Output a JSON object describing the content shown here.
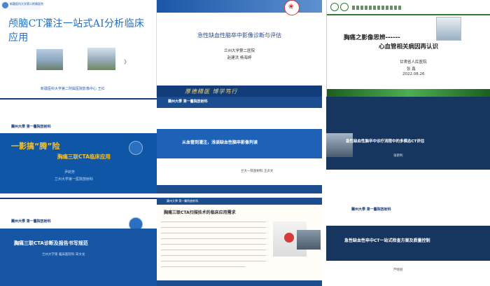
{
  "tiles": {
    "t1": {
      "logo_text": "新疆医科大学第二附属医院",
      "title": "颅脑CT灌注一站式AI分析临床应用",
      "footer": "新疆医科大学第二附属医院影像中心    王红"
    },
    "t2": {
      "title": "急性缺血性脑卒中影像诊断与评估",
      "line1": "兰州大学第二医院",
      "line2": "赵建洪  杨海婷",
      "motto": "厚德精医  博学笃行"
    },
    "t3": {
      "title1": "胸痛之影像思辨------",
      "title2": "心血管相关病因再认识",
      "line1": "甘肃省人民医院",
      "line2": "张  鑫",
      "line3": "2022.08.26"
    },
    "t4": {
      "logo": "蘭州大學 第一醫院放射科",
      "title1": "一影搞“腾”险",
      "title2": "胸痛三联CTA临床应用",
      "line1": "尹莉芳",
      "line2": "兰州大学第一医院放射科"
    },
    "t5": {
      "logo": "蘭州大學 第一醫院放射科",
      "title": "从血管到灌注，浅谈缺血性脑卒影像判读",
      "sub": "兰大一院放射科   王贞文"
    },
    "t6": {
      "title": "急性缺血性脑卒中诊疗流程中的多模态CT评估",
      "name": "张艳利"
    },
    "t7": {
      "logo": "蘭州大學 第一醫院放射科",
      "title": "胸痛三联CTA诊断及报告书写规范",
      "sub": "兰州大学第    临床医院科    宋文龙"
    },
    "t8": {
      "logo": "蘭州大學 第一醫院放射科",
      "title": "胸痛三联CTA扫描技术的临床应用需求"
    },
    "t9": {
      "logo": "蘭州大學 第一醫院放射科",
      "title": "急性缺血性卒中CT一站式检查方案及质量控制",
      "name": "芦晓丽"
    }
  }
}
